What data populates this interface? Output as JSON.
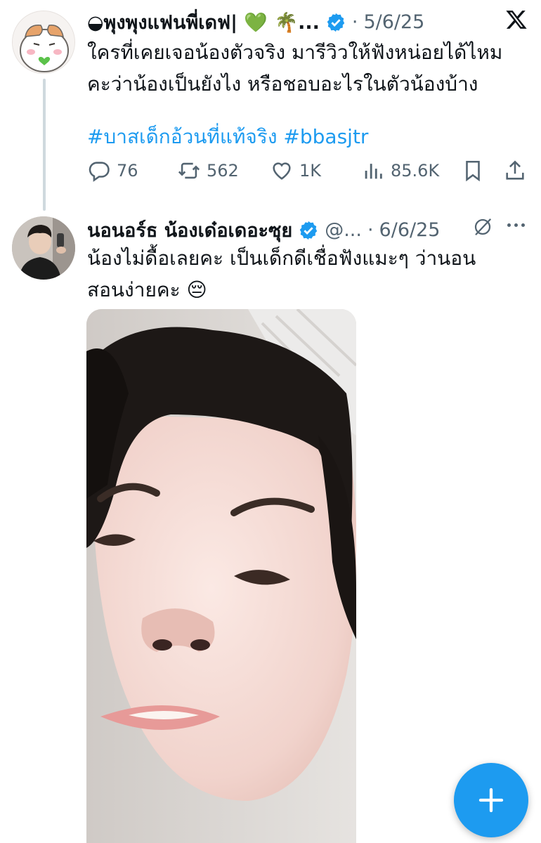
{
  "tweet1": {
    "display_name": "◒พุงพุงแฟนพี่เดฟ| 💚 🌴...",
    "date_sep": "·",
    "date": "5/6/25",
    "text_line1": "ใครที่เคยเจอน้องตัวจริง มารีวิวให้ฟังหน่อยได้ไหม",
    "text_line2": "คะว่าน้องเป็นยังไง  หรือชอบอะไรในตัวน้องบ้าง",
    "hashtags": "#บาสเด็กอ้วนที่แท้จริง #bbasjtr",
    "replies": "76",
    "retweets": "562",
    "likes": "1K",
    "views": "85.6K"
  },
  "tweet2": {
    "display_name": "นอนอร์ธ น้องเด๋อเดอะซุย",
    "handle": "@...",
    "date_sep": "·",
    "date": "6/6/25",
    "text_line1": "น้องไม่ดื้อเลยคะ เป็นเด็กดีเชื่อฟังแมะๆ ว่านอน",
    "text_line2": "สอนง่ายคะ 😔"
  },
  "icons": {
    "x_logo": "x-logo-icon",
    "verified": "verified-badge-icon",
    "reply": "reply-icon",
    "retweet": "retweet-icon",
    "like": "heart-icon",
    "views": "views-icon",
    "bookmark": "bookmark-icon",
    "share": "share-icon",
    "grok": "grok-icon",
    "more": "more-icon",
    "compose": "plus-icon"
  },
  "colors": {
    "accent": "#1d9bf0",
    "text_primary": "#0f1419",
    "text_secondary": "#536471",
    "thread_line": "#cfd9de"
  }
}
